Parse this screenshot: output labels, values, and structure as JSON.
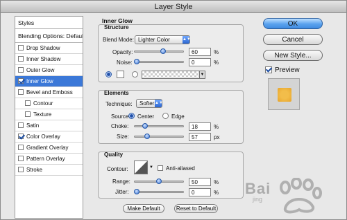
{
  "window": {
    "title": "Layer Style"
  },
  "sidebar": {
    "header": "Styles",
    "blending": "Blending Options: Default",
    "items": [
      {
        "label": "Drop Shadow",
        "checked": false,
        "selected": false,
        "sub": false
      },
      {
        "label": "Inner Shadow",
        "checked": false,
        "selected": false,
        "sub": false
      },
      {
        "label": "Outer Glow",
        "checked": false,
        "selected": false,
        "sub": false
      },
      {
        "label": "Inner Glow",
        "checked": true,
        "selected": true,
        "sub": false
      },
      {
        "label": "Bevel and Emboss",
        "checked": false,
        "selected": false,
        "sub": false
      },
      {
        "label": "Contour",
        "checked": false,
        "selected": false,
        "sub": true
      },
      {
        "label": "Texture",
        "checked": false,
        "selected": false,
        "sub": true
      },
      {
        "label": "Satin",
        "checked": false,
        "selected": false,
        "sub": false
      },
      {
        "label": "Color Overlay",
        "checked": true,
        "selected": false,
        "sub": false
      },
      {
        "label": "Gradient Overlay",
        "checked": false,
        "selected": false,
        "sub": false
      },
      {
        "label": "Pattern Overlay",
        "checked": false,
        "selected": false,
        "sub": false
      },
      {
        "label": "Stroke",
        "checked": false,
        "selected": false,
        "sub": false
      }
    ]
  },
  "panel": {
    "title": "Inner Glow",
    "structure": {
      "title": "Structure",
      "blend_mode_label": "Blend Mode:",
      "blend_mode_value": "Lighter Color",
      "opacity_label": "Opacity:",
      "opacity_value": "60",
      "opacity_unit": "%",
      "opacity_fraction": 0.6,
      "noise_label": "Noise:",
      "noise_value": "0",
      "noise_unit": "%",
      "noise_fraction": 0
    },
    "elements": {
      "title": "Elements",
      "technique_label": "Technique:",
      "technique_value": "Softer",
      "source_label": "Source:",
      "source_center": "Center",
      "source_edge": "Edge",
      "choke_label": "Choke:",
      "choke_value": "18",
      "choke_unit": "%",
      "choke_fraction": 0.18,
      "size_label": "Size:",
      "size_value": "57",
      "size_unit": "px",
      "size_fraction": 0.23
    },
    "quality": {
      "title": "Quality",
      "contour_label": "Contour:",
      "anti_aliased_label": "Anti-aliased",
      "range_label": "Range:",
      "range_value": "50",
      "range_unit": "%",
      "range_fraction": 0.5,
      "jitter_label": "Jitter:",
      "jitter_value": "0",
      "jitter_unit": "%",
      "jitter_fraction": 0
    },
    "make_default": "Make Default",
    "reset_default": "Reset to Default"
  },
  "actions": {
    "ok": "OK",
    "cancel": "Cancel",
    "new_style": "New Style...",
    "preview_label": "Preview"
  },
  "watermark": {
    "main": "Bai",
    "sub": "jing"
  },
  "colors": {
    "selection": "#3b78d8",
    "preview_swatch": "#f2bd4a",
    "accent": "#2c66d0"
  }
}
